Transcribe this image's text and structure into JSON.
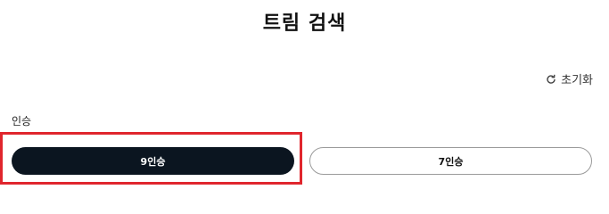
{
  "header": {
    "title": "트림 검색"
  },
  "toolbar": {
    "reset_label": "초기화",
    "reset_icon": "refresh-icon"
  },
  "filter": {
    "label": "인승",
    "options": [
      {
        "label": "9인승",
        "selected": true
      },
      {
        "label": "7인승",
        "selected": false
      }
    ]
  },
  "colors": {
    "selected_bg": "#0b1520",
    "highlight_border": "#e0262d"
  }
}
